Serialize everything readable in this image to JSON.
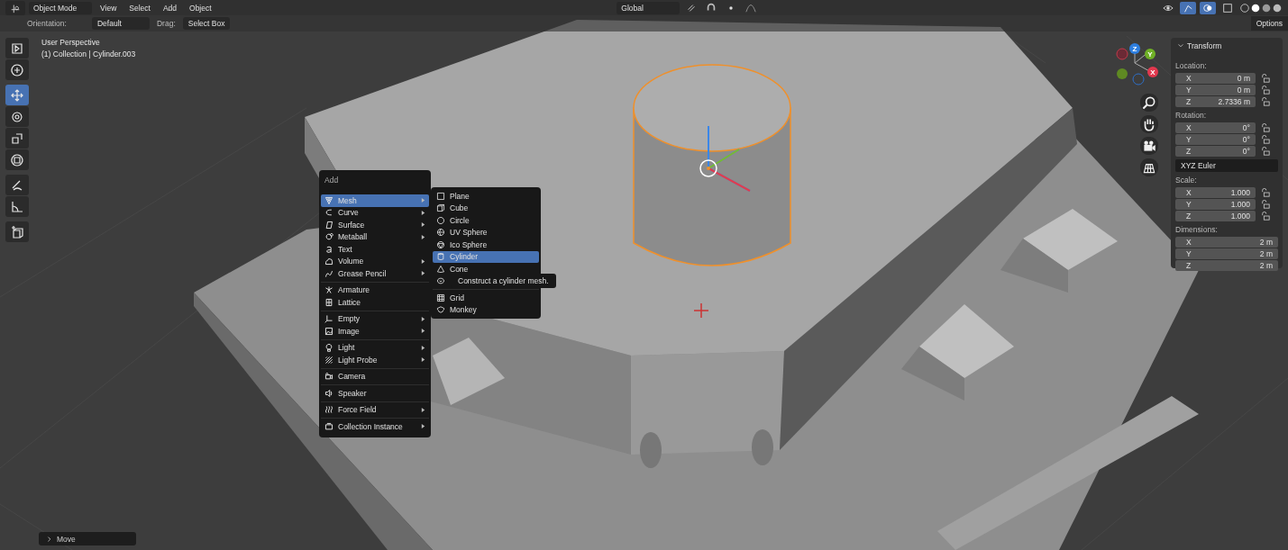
{
  "header": {
    "mode": "Object Mode",
    "menus": [
      "View",
      "Select",
      "Add",
      "Object"
    ],
    "orientation": "Global",
    "options": "Options"
  },
  "tool_settings": {
    "orientation_label": "Orientation:",
    "orientation": "Default",
    "drag_label": "Drag:",
    "drag": "Select Box"
  },
  "toolbar": [
    [
      {
        "kind": "select",
        "selected": false
      },
      {
        "kind": "cursor",
        "selected": false
      }
    ],
    [
      {
        "kind": "move",
        "selected": true
      },
      {
        "kind": "rotate",
        "selected": false
      },
      {
        "kind": "scale",
        "selected": false
      },
      {
        "kind": "transform",
        "selected": false
      }
    ],
    [
      {
        "kind": "annotate",
        "selected": false
      },
      {
        "kind": "measure",
        "selected": false
      }
    ],
    [
      {
        "kind": "add-cube",
        "selected": false
      }
    ]
  ],
  "viewport": {
    "view_name": "User Perspective",
    "object_info": "(1) Collection | Cylinder.003"
  },
  "gizmo": {
    "z": "Z",
    "y": "Y",
    "x": "X"
  },
  "add_menu": {
    "title": "Add",
    "groups": [
      [
        {
          "label": "Mesh",
          "kind": "mesh",
          "submenu": true,
          "selected": true
        },
        {
          "label": "Curve",
          "kind": "curve",
          "submenu": true,
          "selected": false
        },
        {
          "label": "Surface",
          "kind": "surface",
          "submenu": true,
          "selected": false
        },
        {
          "label": "Metaball",
          "kind": "metaball",
          "submenu": true,
          "selected": false
        },
        {
          "label": "Text",
          "kind": "text",
          "submenu": false,
          "selected": false
        },
        {
          "label": "Volume",
          "kind": "volume",
          "submenu": true,
          "selected": false
        },
        {
          "label": "Grease Pencil",
          "kind": "pencil",
          "submenu": true,
          "selected": false
        }
      ],
      [
        {
          "label": "Armature",
          "kind": "armature",
          "submenu": false,
          "selected": false
        },
        {
          "label": "Lattice",
          "kind": "lattice",
          "submenu": false,
          "selected": false
        }
      ],
      [
        {
          "label": "Empty",
          "kind": "empty",
          "submenu": true,
          "selected": false
        },
        {
          "label": "Image",
          "kind": "image",
          "submenu": true,
          "selected": false
        }
      ],
      [
        {
          "label": "Light",
          "kind": "light",
          "submenu": true,
          "selected": false
        },
        {
          "label": "Light Probe",
          "kind": "probe",
          "submenu": true,
          "selected": false
        }
      ],
      [
        {
          "label": "Camera",
          "kind": "camera",
          "submenu": false,
          "selected": false
        }
      ],
      [
        {
          "label": "Speaker",
          "kind": "speaker",
          "submenu": false,
          "selected": false
        }
      ],
      [
        {
          "label": "Force Field",
          "kind": "force",
          "submenu": true,
          "selected": false
        }
      ],
      [
        {
          "label": "Collection Instance",
          "kind": "collection",
          "submenu": true,
          "selected": false
        }
      ]
    ]
  },
  "mesh_menu": {
    "groups": [
      [
        {
          "label": "Plane",
          "kind": "plane",
          "selected": false
        },
        {
          "label": "Cube",
          "kind": "cube",
          "selected": false
        },
        {
          "label": "Circle",
          "kind": "circle",
          "selected": false
        },
        {
          "label": "UV Sphere",
          "kind": "uvsphere",
          "selected": false
        },
        {
          "label": "Ico Sphere",
          "kind": "icosphere",
          "selected": false
        },
        {
          "label": "Cylinder",
          "kind": "cylinder",
          "selected": true
        },
        {
          "label": "Cone",
          "kind": "cone",
          "selected": false
        },
        {
          "kind": "torus",
          "selected": false
        }
      ],
      [
        {
          "label": "Grid",
          "kind": "grid",
          "selected": false
        },
        {
          "label": "Monkey",
          "kind": "monkey",
          "selected": false
        }
      ]
    ]
  },
  "tooltip": "Construct a cylinder mesh.",
  "sidebar": {
    "title": "Transform",
    "sections": [
      {
        "label": "Location:",
        "fields": [
          {
            "axis": "X",
            "value": "0 m",
            "locked": false
          },
          {
            "axis": "Y",
            "value": "0 m",
            "locked": false
          },
          {
            "axis": "Z",
            "value": "2.7336 m",
            "locked": false
          }
        ]
      },
      {
        "label": "Rotation:",
        "fields": [
          {
            "axis": "X",
            "value": "0°",
            "locked": false
          },
          {
            "axis": "Y",
            "value": "0°",
            "locked": false
          },
          {
            "axis": "Z",
            "value": "0°",
            "locked": false
          }
        ],
        "mode": "XYZ Euler"
      },
      {
        "label": "Scale:",
        "fields": [
          {
            "axis": "X",
            "value": "1.000",
            "locked": false
          },
          {
            "axis": "Y",
            "value": "1.000",
            "locked": false
          },
          {
            "axis": "Z",
            "value": "1.000",
            "locked": false
          }
        ]
      },
      {
        "label": "Dimensions:",
        "fields": [
          {
            "axis": "X",
            "value": "2 m"
          },
          {
            "axis": "Y",
            "value": "2 m"
          },
          {
            "axis": "Z",
            "value": "2 m"
          }
        ]
      }
    ]
  },
  "last_operator": "Move"
}
